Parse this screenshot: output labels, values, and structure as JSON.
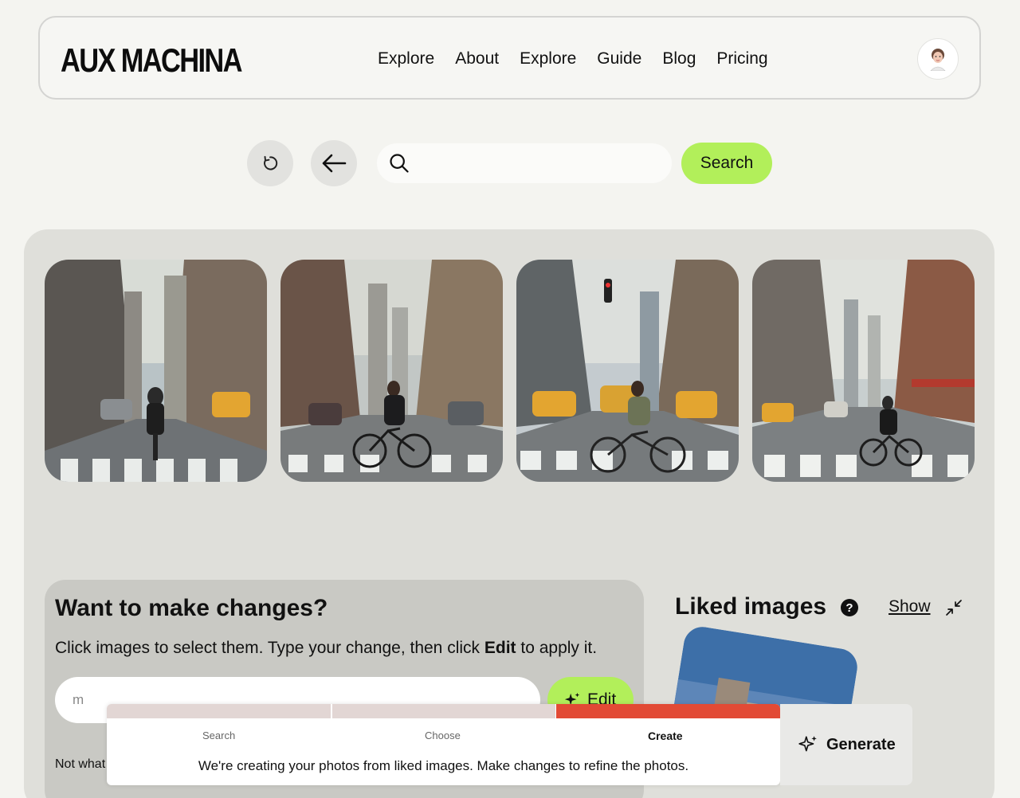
{
  "header": {
    "logo": "AUX MACHINA",
    "nav": [
      "Explore",
      "About",
      "Explore",
      "Guide",
      "Blog",
      "Pricing"
    ]
  },
  "search": {
    "value": "",
    "button_label": "Search"
  },
  "photos": [
    {
      "alt": "Cyclist riding away down a city avenue"
    },
    {
      "alt": "Cyclist crossing a crosswalk"
    },
    {
      "alt": "Cyclist crossing in front of taxis"
    },
    {
      "alt": "Cyclist on a wide avenue with skyline"
    }
  ],
  "changes": {
    "title": "Want to make changes?",
    "desc_before": "Click images to select them. Type your change, then click ",
    "desc_bold": "Edit",
    "desc_after": " to apply it.",
    "input_value": "m",
    "edit_label": "Edit",
    "not_what": "Not what"
  },
  "liked": {
    "title": "Liked images",
    "help": "?",
    "show_label": "Show"
  },
  "progress": {
    "steps": [
      "Search",
      "Choose",
      "Create"
    ],
    "active_step": "Create",
    "message": "We're creating your photos from liked images. Make changes to refine the photos.",
    "generate_label": "Generate"
  },
  "colors": {
    "accent_green": "#b2ef5a",
    "progress_done": "#e2d6d4",
    "progress_active": "#e24a35"
  }
}
